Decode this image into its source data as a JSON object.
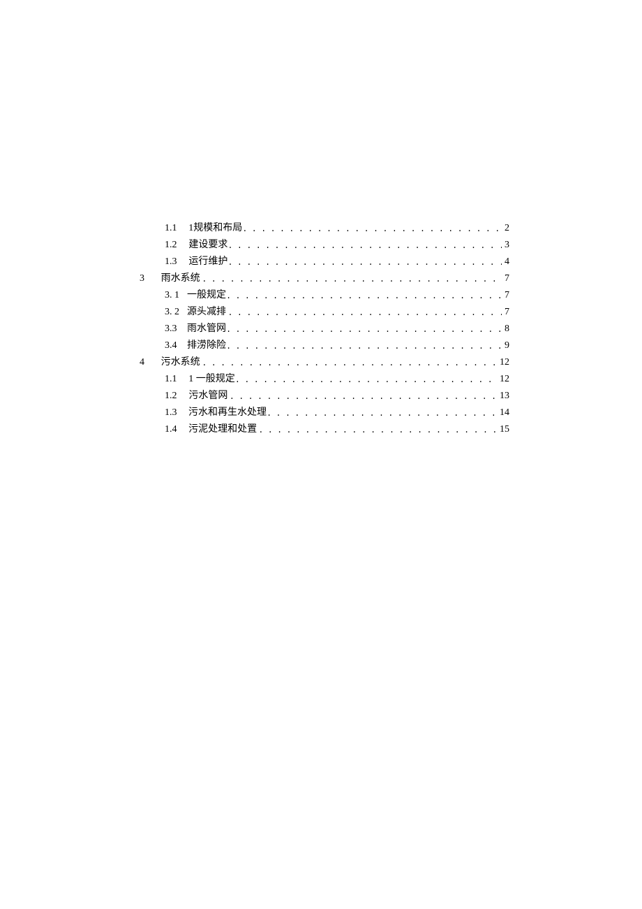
{
  "toc": {
    "entries": [
      {
        "level": 2,
        "num": "1.1",
        "title": "1规模和布局",
        "page": "2"
      },
      {
        "level": 2,
        "num": "1.2",
        "title": "建设要求",
        "page": "3"
      },
      {
        "level": 2,
        "num": "1.3",
        "title": "运行维护",
        "page": "4"
      },
      {
        "level": 1,
        "num": "3",
        "title": "雨水系统",
        "page": "7"
      },
      {
        "level": 2,
        "num": "3. 1",
        "title": "一般规定",
        "page": "7"
      },
      {
        "level": 2,
        "num": "3. 2",
        "title": "源头减排",
        "page": "7"
      },
      {
        "level": 2,
        "num": "3.3",
        "title": "雨水管网",
        "page": "8"
      },
      {
        "level": 2,
        "num": "3.4",
        "title": "排涝除险",
        "page": "9"
      },
      {
        "level": 1,
        "num": "4",
        "title": "污水系统",
        "page": "12"
      },
      {
        "level": 2,
        "num": "1.1",
        "title": "1 一般规定",
        "page": "12"
      },
      {
        "level": 2,
        "num": "1.2",
        "title": "污水管网",
        "page": "13"
      },
      {
        "level": 2,
        "num": "1.3",
        "title": "污水和再生水处理",
        "page": "14"
      },
      {
        "level": 2,
        "num": "1.4",
        "title": "污泥处理和处置",
        "page": "15"
      }
    ]
  }
}
